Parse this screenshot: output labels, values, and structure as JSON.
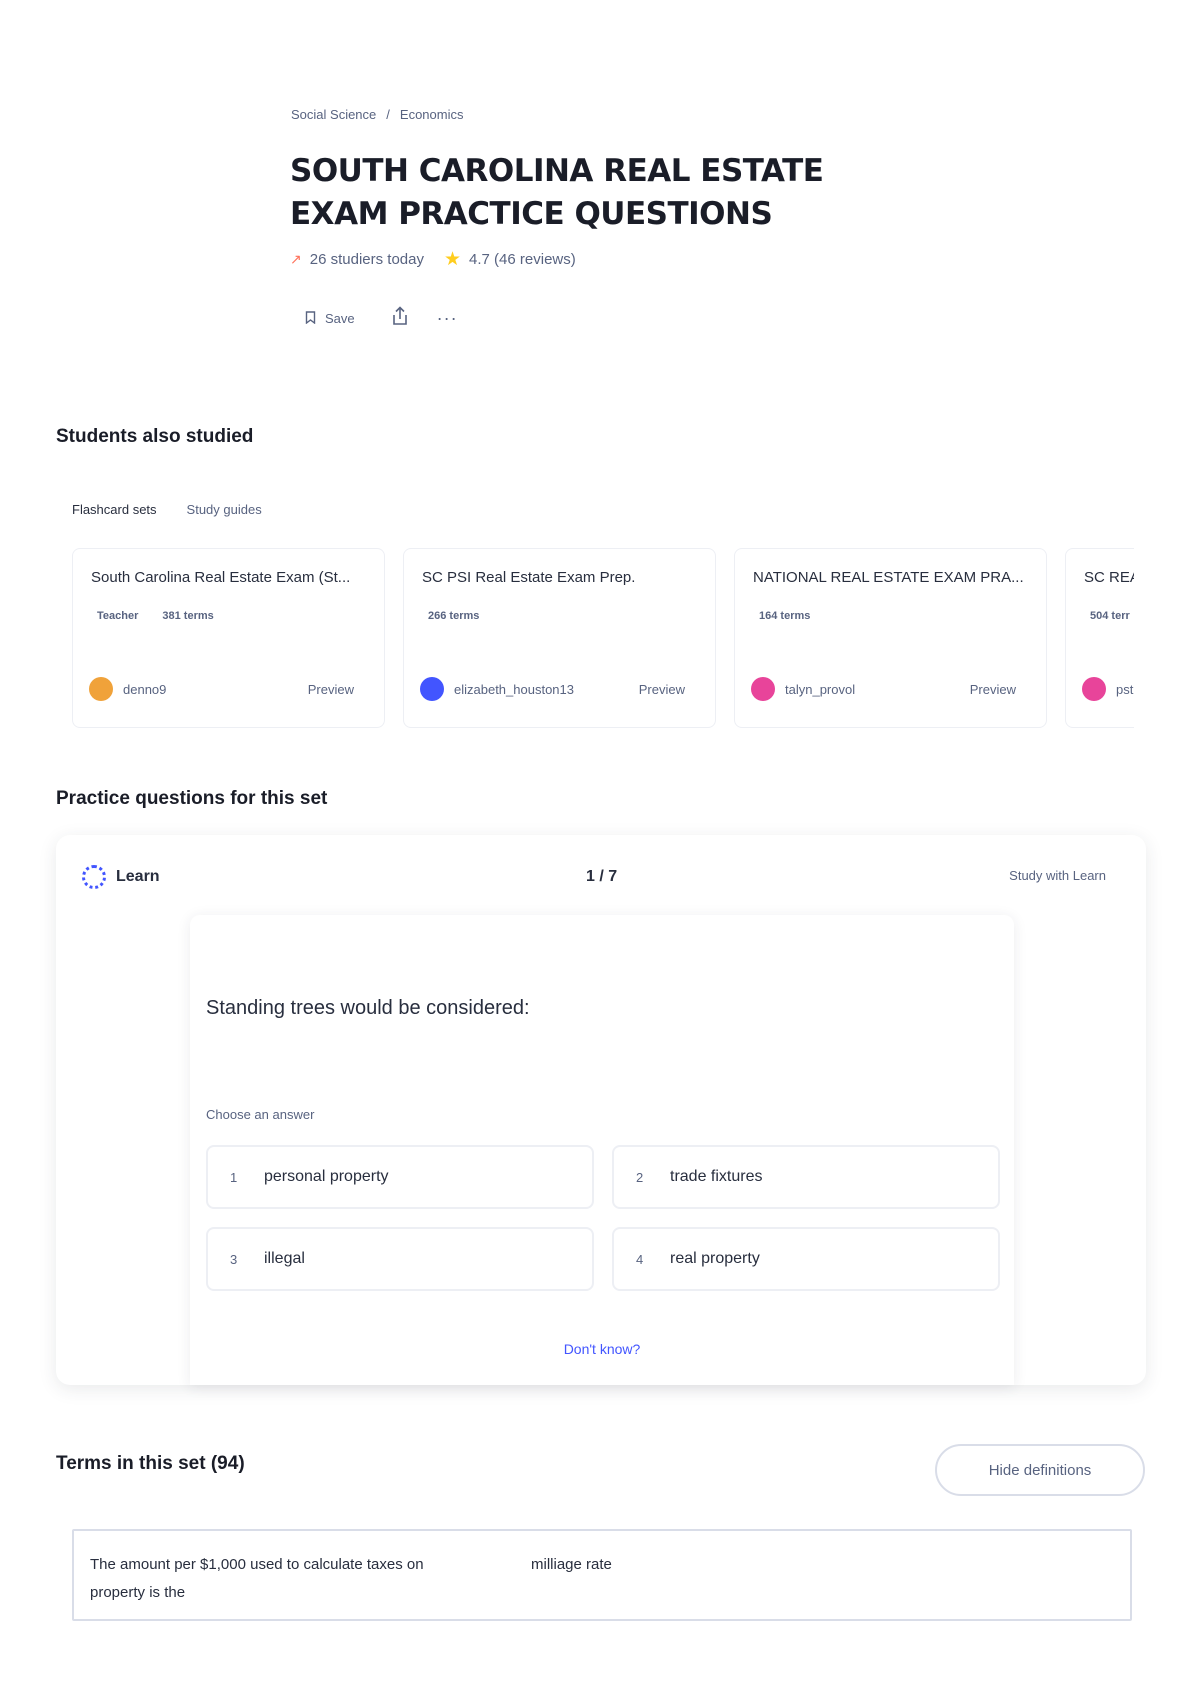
{
  "breadcrumb": {
    "items": [
      "Social Science",
      "Economics"
    ],
    "separator": "/"
  },
  "header": {
    "title": "SOUTH CAROLINA REAL ESTATE EXAM PRACTICE QUESTIONS",
    "studiers": "26 studiers today",
    "rating": "4.7 (46 reviews)"
  },
  "actions": {
    "save_label": "Save"
  },
  "students_also_studied": {
    "title": "Students also studied",
    "tabs": [
      "Flashcard sets",
      "Study guides"
    ],
    "cards": [
      {
        "title": "South Carolina Real Estate Exam (St...",
        "meta": [
          "Teacher",
          "381 terms"
        ],
        "user": "denno9",
        "preview": "Preview",
        "avatar_color": "#f0a23a"
      },
      {
        "title": "SC PSI Real Estate Exam Prep.",
        "meta": [
          "266 terms"
        ],
        "user": "elizabeth_houston13",
        "preview": "Preview",
        "avatar_color": "#4255ff"
      },
      {
        "title": "NATIONAL REAL ESTATE EXAM PRA...",
        "meta": [
          "164 terms"
        ],
        "user": "talyn_provol",
        "preview": "Preview",
        "avatar_color": "#e8449a"
      },
      {
        "title": "SC REA",
        "meta": [
          "504 terr"
        ],
        "user": "pst",
        "preview": "",
        "avatar_color": "#e8449a"
      }
    ]
  },
  "practice": {
    "title": "Practice questions for this set",
    "mode_label": "Learn",
    "progress": "1 / 7",
    "study_link": "Study with Learn",
    "question": "Standing trees would be considered:",
    "choose_label": "Choose an answer",
    "answers": [
      {
        "num": "1",
        "text": "personal property"
      },
      {
        "num": "2",
        "text": "trade fixtures"
      },
      {
        "num": "3",
        "text": "illegal"
      },
      {
        "num": "4",
        "text": "real property"
      }
    ],
    "dont_know": "Don't know?"
  },
  "terms": {
    "title": "Terms in this set (94)",
    "hide_button": "Hide definitions",
    "items": [
      {
        "term": "The amount per $1,000 used to calculate taxes on property is the",
        "definition": "milliage rate"
      }
    ]
  },
  "colors": {
    "accent": "#4255ff",
    "text": "#282e3e",
    "muted": "#586380",
    "star": "#ffcd1f",
    "trend": "#ff725b"
  }
}
